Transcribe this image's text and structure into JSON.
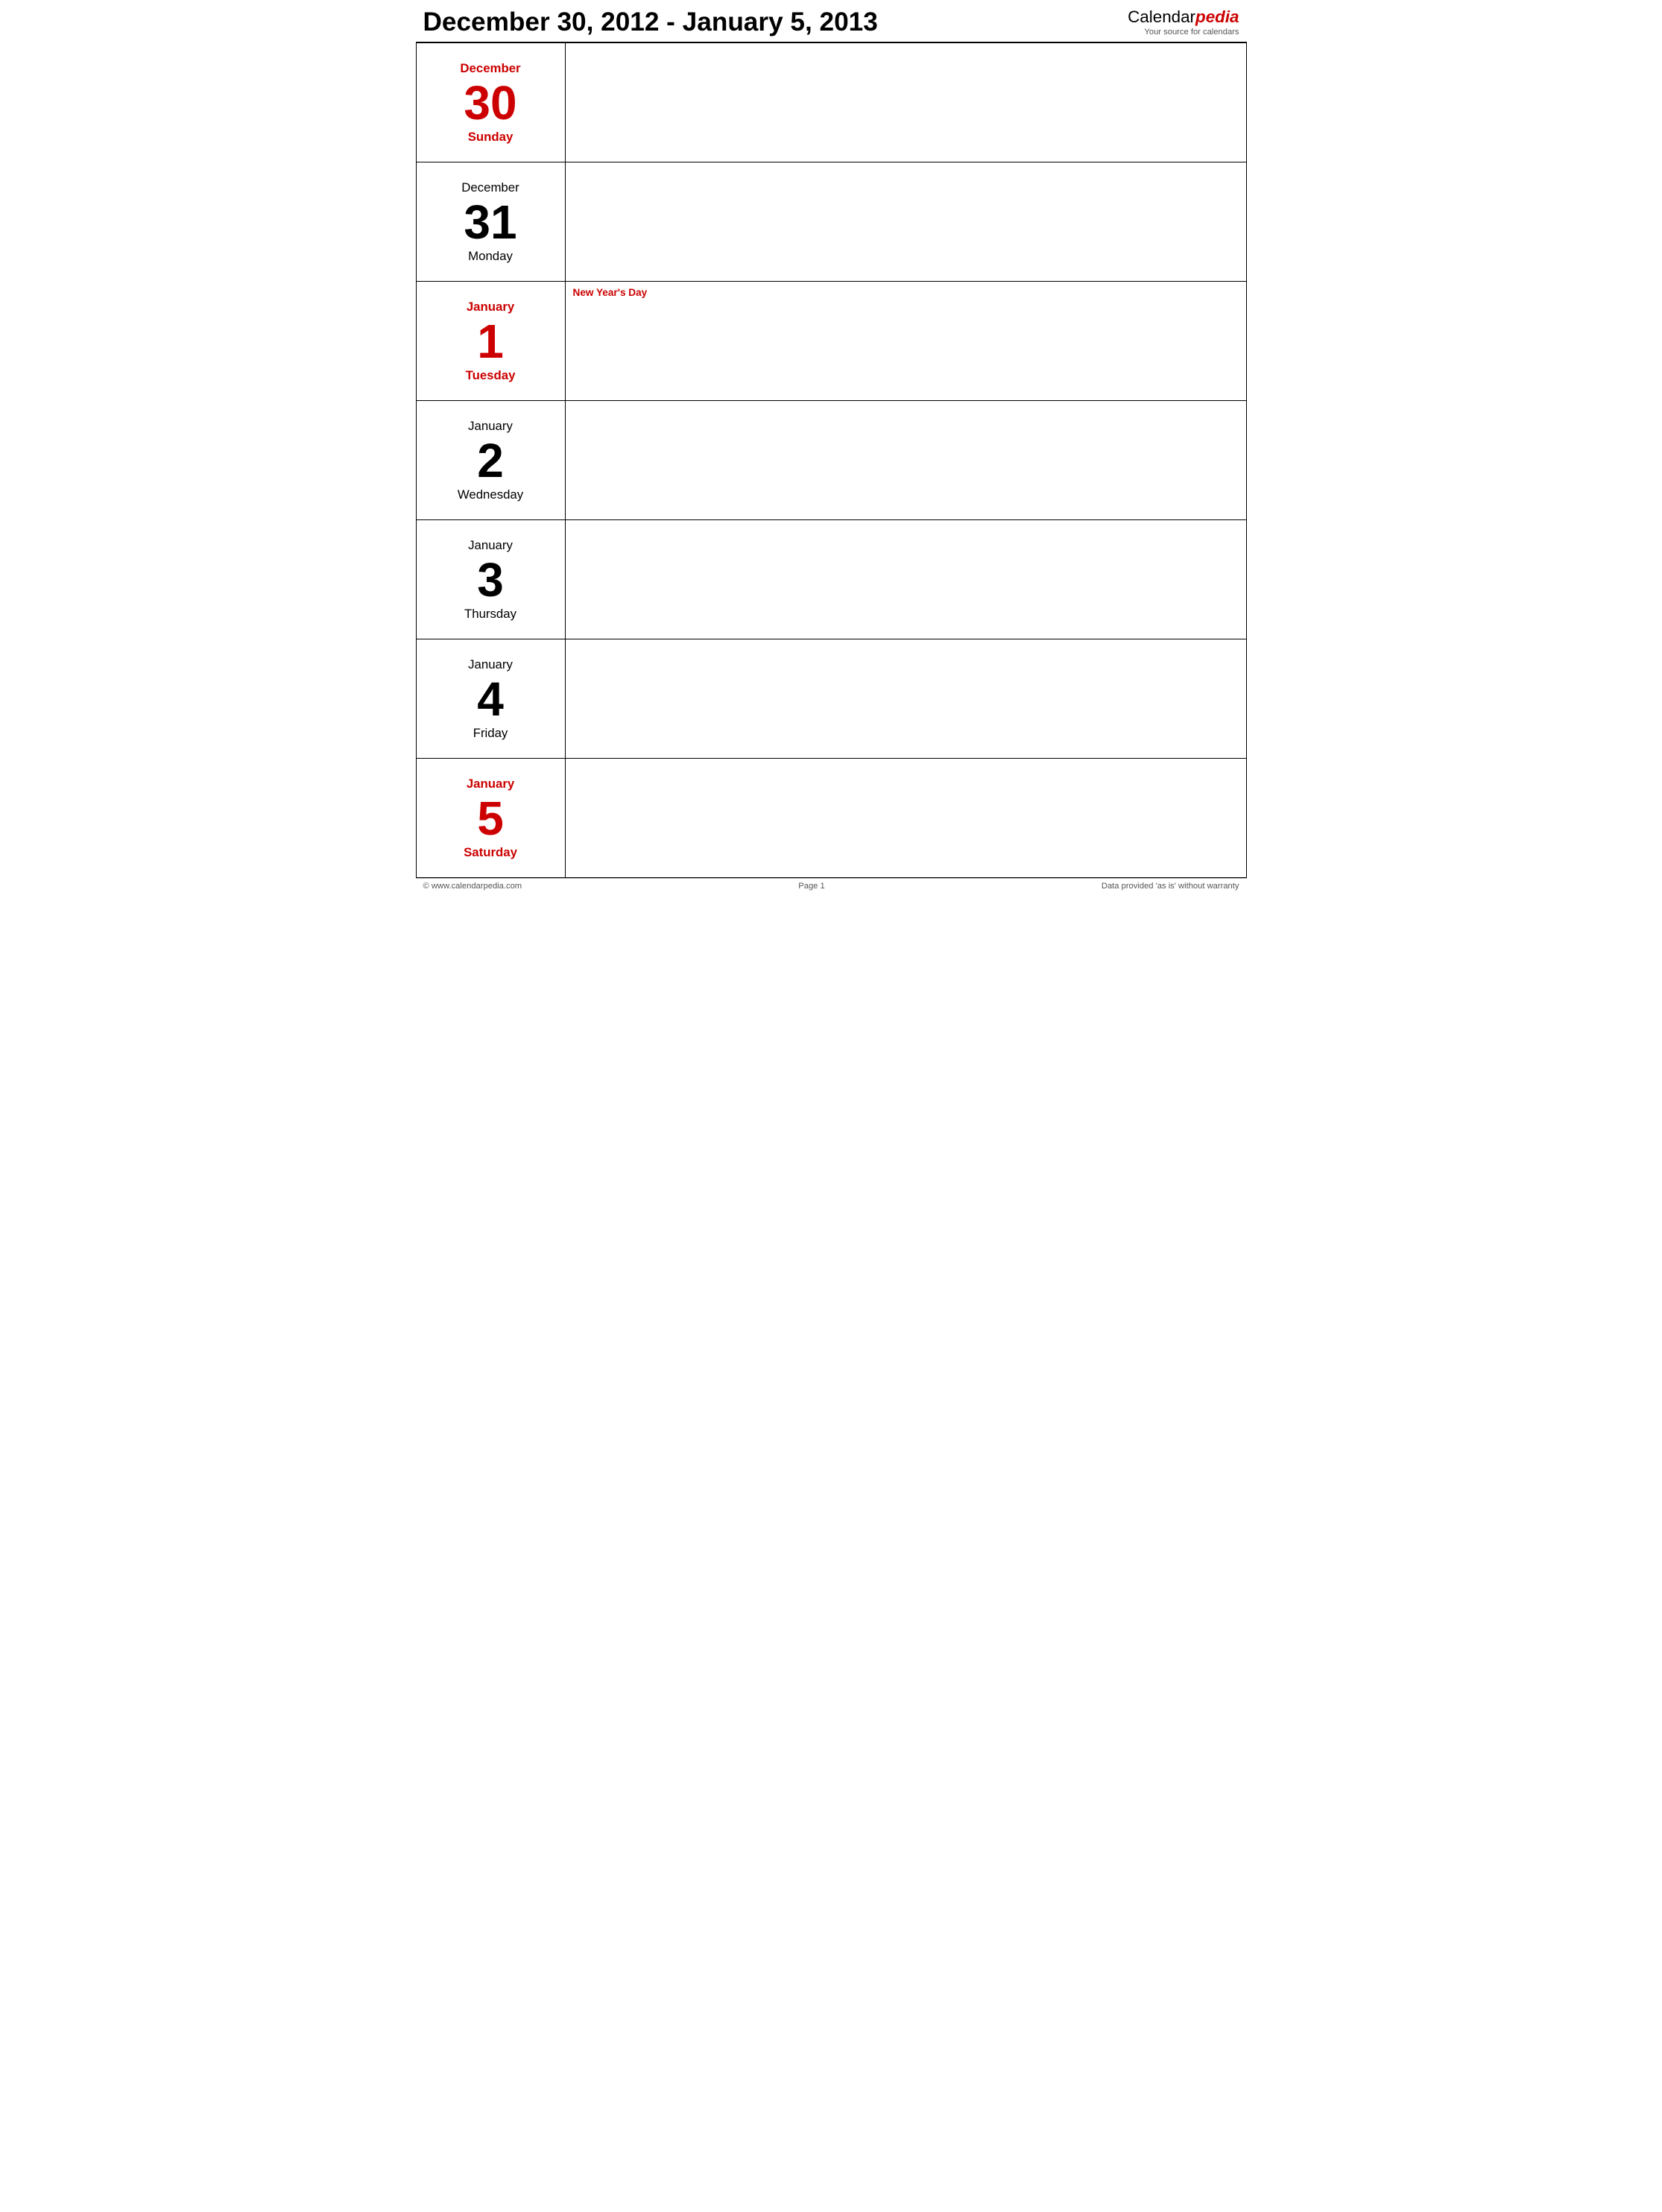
{
  "header": {
    "title": "December 30, 2012 - January 5, 2013",
    "logo_brand": "Calendar",
    "logo_brand_accent": "pedia",
    "logo_tagline": "Your source for calendars"
  },
  "days": [
    {
      "month": "December",
      "number": "30",
      "dayname": "Sunday",
      "highlight": true,
      "holiday": ""
    },
    {
      "month": "December",
      "number": "31",
      "dayname": "Monday",
      "highlight": false,
      "holiday": ""
    },
    {
      "month": "January",
      "number": "1",
      "dayname": "Tuesday",
      "highlight": true,
      "holiday": "New Year's Day"
    },
    {
      "month": "January",
      "number": "2",
      "dayname": "Wednesday",
      "highlight": false,
      "holiday": ""
    },
    {
      "month": "January",
      "number": "3",
      "dayname": "Thursday",
      "highlight": false,
      "holiday": ""
    },
    {
      "month": "January",
      "number": "4",
      "dayname": "Friday",
      "highlight": false,
      "holiday": ""
    },
    {
      "month": "January",
      "number": "5",
      "dayname": "Saturday",
      "highlight": true,
      "holiday": ""
    }
  ],
  "footer": {
    "left": "© www.calendarpedia.com",
    "center": "Page 1",
    "right": "Data provided 'as is' without warranty"
  }
}
